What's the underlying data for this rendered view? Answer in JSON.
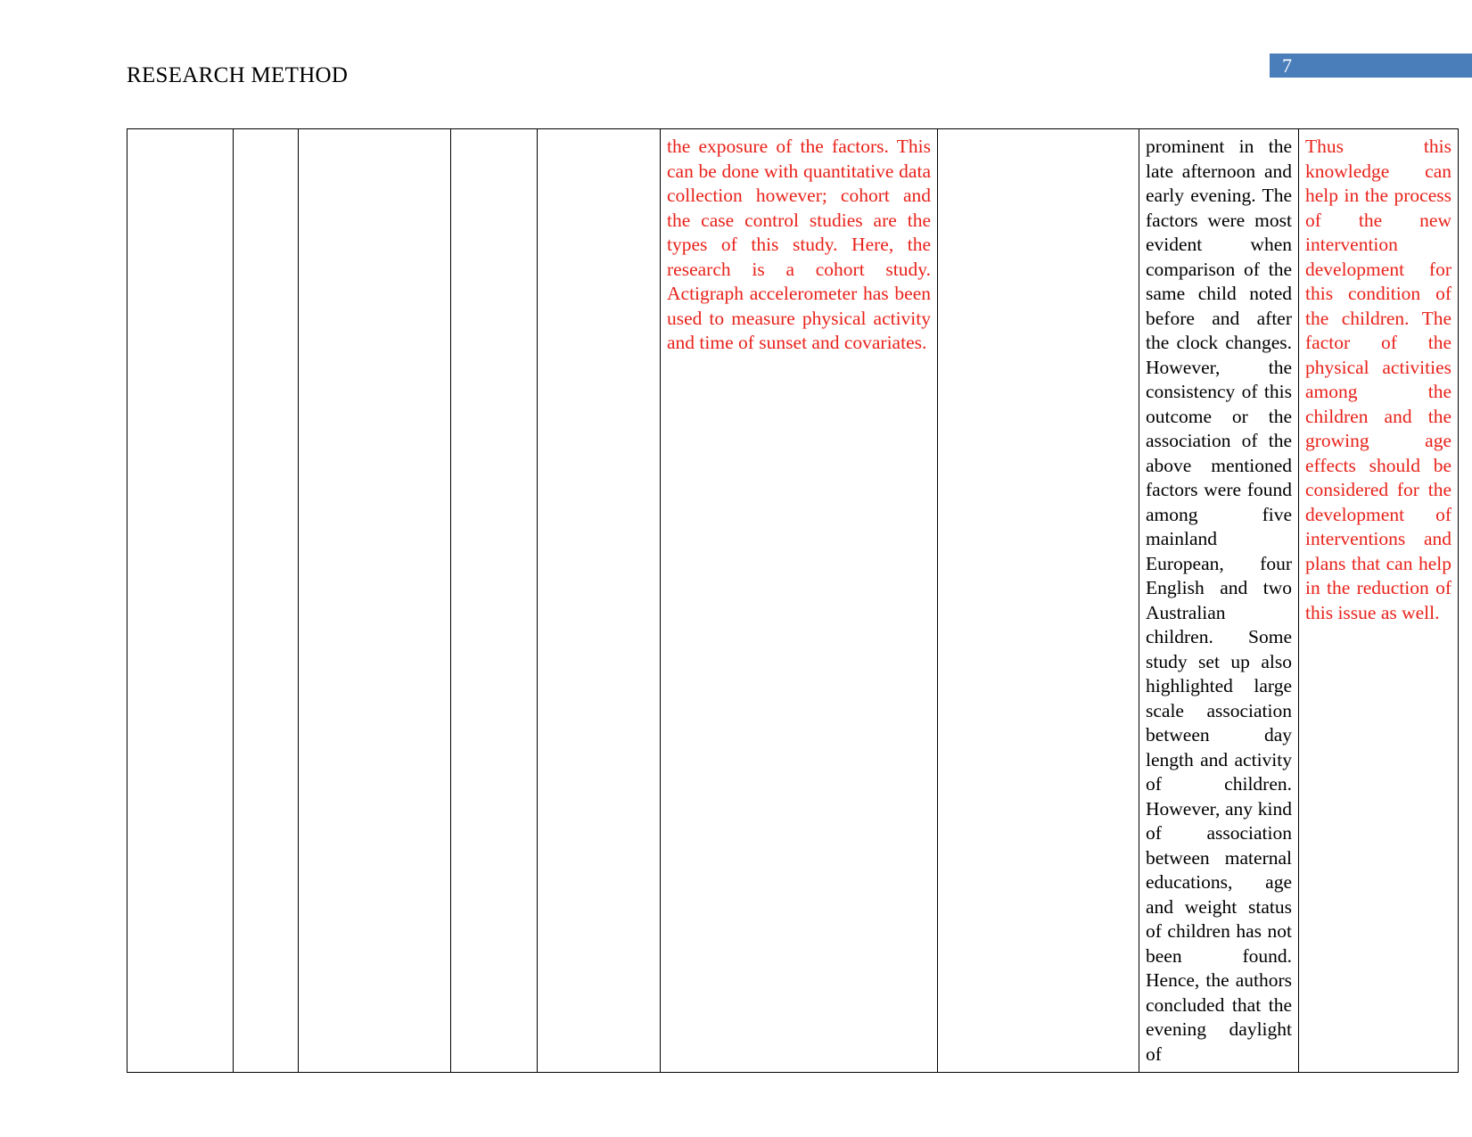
{
  "header": {
    "title": "RESEARCH METHOD",
    "page_number": "7",
    "badge_color": "#4A7EBB"
  },
  "colors": {
    "red_text": "#E8221A",
    "black_text": "#000000",
    "table_border": "#000000"
  },
  "table": {
    "row": {
      "cells": [
        {
          "id": "col-1",
          "text": "",
          "color": "black"
        },
        {
          "id": "col-2",
          "text": "",
          "color": "black"
        },
        {
          "id": "col-3",
          "text": "",
          "color": "black"
        },
        {
          "id": "col-4",
          "text": "",
          "color": "black"
        },
        {
          "id": "col-5",
          "text": "",
          "color": "black"
        },
        {
          "id": "col-6-method",
          "color": "red",
          "text": "the exposure of the factors. This can be done with quantitative data collection however; cohort and the case control studies are the types of this study. Here, the research is a cohort study. Actigraph accelerometer has been used to measure physical activity and time of sunset and covariates."
        },
        {
          "id": "col-7",
          "text": "",
          "color": "black"
        },
        {
          "id": "col-8-findings",
          "color": "black",
          "text": "prominent in the late afternoon and early evening. The factors were most evident when comparison of the same child noted before and after the clock changes. However, the consistency of this outcome or the association of the above mentioned factors were found among five mainland European, four English and two Australian children. Some study set up also highlighted large scale association between day length and activity of children. However, any kind of association between maternal educations, age and weight status of children has not been found. Hence, the authors concluded that the evening daylight of"
        },
        {
          "id": "col-9-conclusion",
          "color": "red",
          "text": "Thus this knowledge can help in the process of the new intervention development for this condition of the children. The factor of the physical activities among the children and the growing age effects should be considered for the development of interventions and plans that can help in the reduction of this issue as well."
        }
      ]
    }
  }
}
